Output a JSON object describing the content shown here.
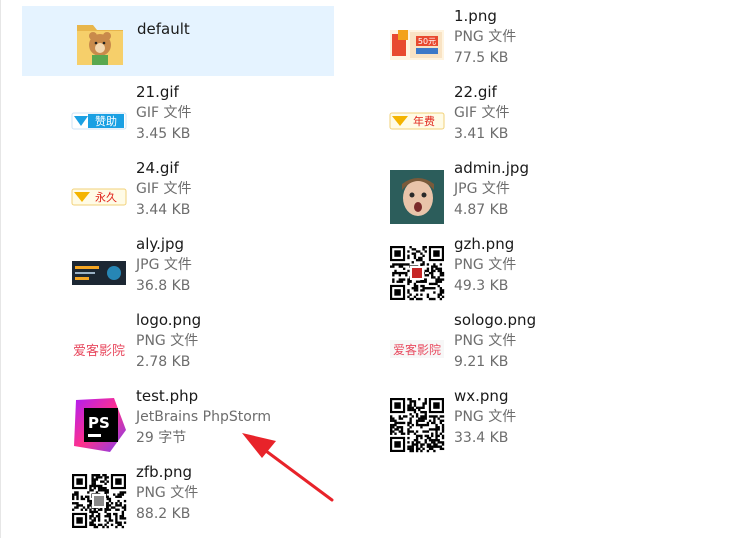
{
  "files": [
    {
      "name": "default",
      "type": "",
      "size": "",
      "icon": "folder-icon",
      "selected": true
    },
    {
      "name": "1.png",
      "type": "PNG 文件",
      "size": "77.5 KB",
      "icon": "promo-banner-thumbnail"
    },
    {
      "name": "21.gif",
      "type": "GIF 文件",
      "size": "3.45 KB",
      "icon": "sponsor-badge-thumbnail"
    },
    {
      "name": "22.gif",
      "type": "GIF 文件",
      "size": "3.41 KB",
      "icon": "annual-badge-thumbnail"
    },
    {
      "name": "24.gif",
      "type": "GIF 文件",
      "size": "3.44 KB",
      "icon": "permanent-badge-thumbnail"
    },
    {
      "name": "admin.jpg",
      "type": "JPG 文件",
      "size": "4.87 KB",
      "icon": "child-photo-thumbnail"
    },
    {
      "name": "aly.jpg",
      "type": "JPG 文件",
      "size": "36.8 KB",
      "icon": "dark-banner-thumbnail"
    },
    {
      "name": "gzh.png",
      "type": "PNG 文件",
      "size": "49.3 KB",
      "icon": "qr-code-thumbnail"
    },
    {
      "name": "logo.png",
      "type": "PNG 文件",
      "size": "2.78 KB",
      "icon": "logo-thumbnail"
    },
    {
      "name": "sologo.png",
      "type": "PNG 文件",
      "size": "9.21 KB",
      "icon": "logo-small-thumbnail"
    },
    {
      "name": "test.php",
      "type": "JetBrains PhpStorm",
      "size": "29 字节",
      "icon": "phpstorm-icon"
    },
    {
      "name": "wx.png",
      "type": "PNG 文件",
      "size": "33.4 KB",
      "icon": "qr-code-thumbnail"
    },
    {
      "name": "zfb.png",
      "type": "PNG 文件",
      "size": "88.2 KB",
      "icon": "qr-code-thumbnail"
    }
  ],
  "thumb_text": {
    "promo": "50元",
    "sponsor": "赞助",
    "annual": "年费",
    "permanent": "永久",
    "logo": "爱客影院",
    "phpstorm": "PS"
  },
  "colors": {
    "selection": "#e5f3ff",
    "annotation_arrow": "#e8232a",
    "phpstorm_pink": "#ff318c",
    "phpstorm_purple": "#7b3ff2"
  }
}
